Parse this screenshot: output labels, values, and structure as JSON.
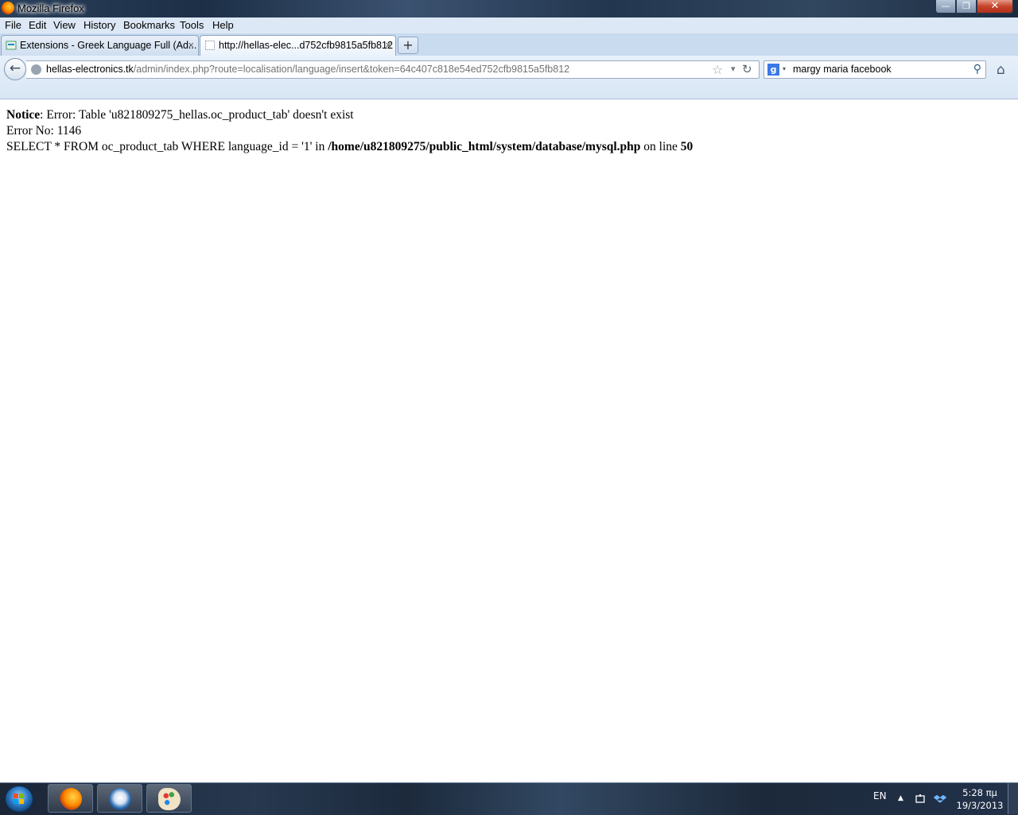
{
  "window": {
    "title": "Mozilla Firefox",
    "controls": {
      "minimize": "—",
      "maximize": "❐",
      "close": "✕"
    }
  },
  "menu": {
    "items": [
      "File",
      "Edit",
      "View",
      "History",
      "Bookmarks",
      "Tools",
      "Help"
    ]
  },
  "tabs": [
    {
      "label": "Extensions - Greek Language Full (Ad...",
      "close": "×",
      "active": false
    },
    {
      "label": "http://hellas-elec...d752cfb9815a5fb812",
      "close": "×",
      "active": true
    }
  ],
  "new_tab": "+",
  "navigation": {
    "back": "←",
    "url_host": "hellas-electronics.tk",
    "url_path": "/admin/index.php?route=localisation/language/insert&token=64c407c818e54ed752cfb9815a5fb812",
    "bookmark_star": "☆",
    "history_drop": "▾",
    "reload": "↻",
    "search_engine": "g",
    "search_engine_drop": "▾",
    "search_query": "margy maria facebook",
    "search_go": "⚲",
    "home": "⌂"
  },
  "page": {
    "notice_label": "Notice",
    "notice_text": ": Error: Table 'u821809275_hellas.oc_product_tab' doesn't exist",
    "error_no": "Error No: 1146",
    "query_text": "SELECT * FROM oc_product_tab WHERE language_id = '1' in ",
    "query_path": "/home/u821809275/public_html/system/database/mysql.php",
    "on_line_text": " on line ",
    "line_number": "50"
  },
  "taskbar": {
    "language": "EN",
    "tray_arrow": "▲",
    "clock_time": "5:28 πμ",
    "clock_date": "19/3/2013"
  },
  "colors": {
    "url_host": "#000000",
    "url_path": "#737373",
    "menubar": "#dce8f5"
  }
}
